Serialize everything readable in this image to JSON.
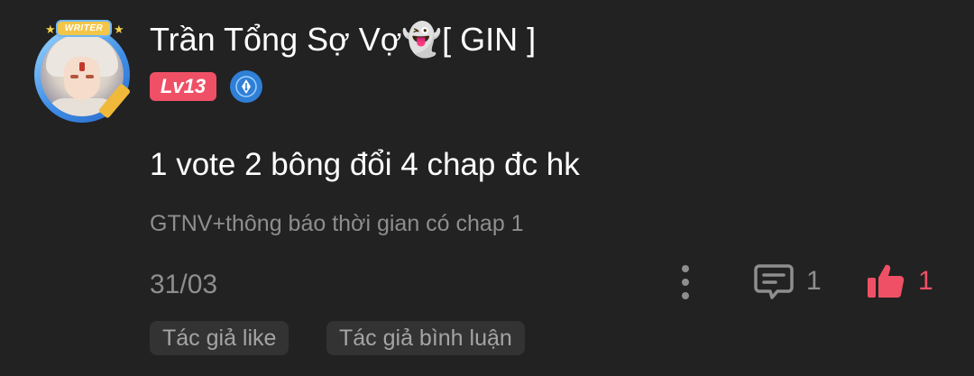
{
  "comment": {
    "username": "Trần Tổng Sợ Vợ👻[ GIN ]",
    "level": "Lv13",
    "avatar_banner": "WRITER",
    "text": "1 vote 2 bông đổi 4 chap đc hk",
    "chapter_ref": "GTNV+thông báo thời gian có chap 1",
    "date": "31/03",
    "reply_count": "1",
    "like_count": "1",
    "tags": [
      "Tác giả like",
      "Tác giả bình luận"
    ]
  },
  "icons": {
    "more": "more-vertical-icon",
    "reply": "comment-bubble-icon",
    "like": "thumbs-up-icon",
    "author_badge": "fountain-pen-icon"
  },
  "colors": {
    "background": "#222222",
    "accent": "#ef5066",
    "muted_text": "#8e8e8e",
    "tag_bg": "#333333",
    "badge_blue": "#2f7fd6"
  }
}
